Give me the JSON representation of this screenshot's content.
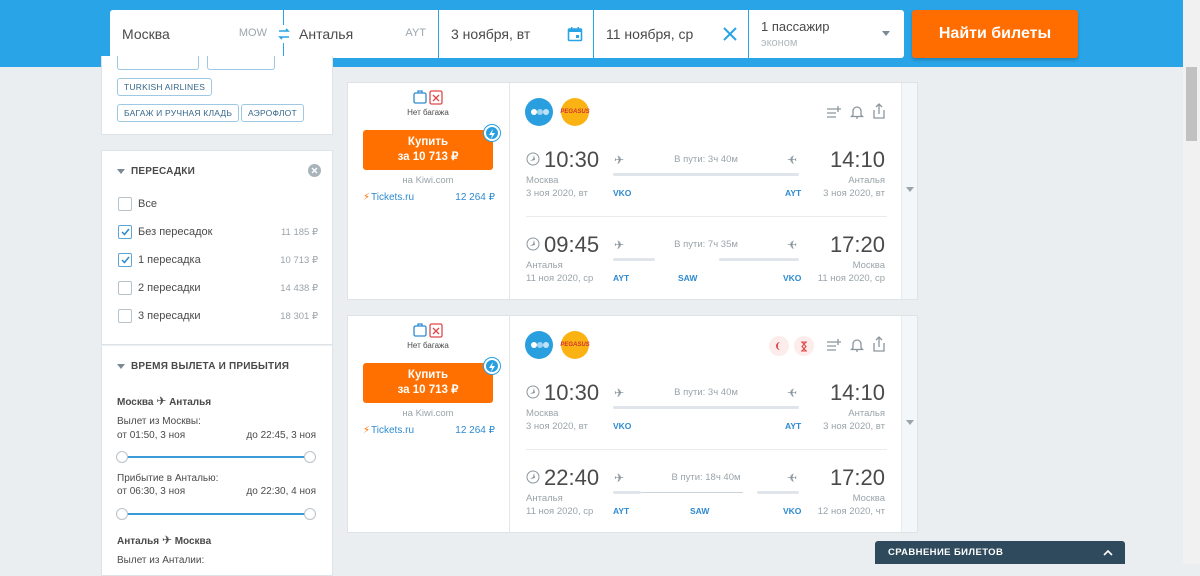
{
  "search": {
    "origin": "Москва",
    "origin_code": "MOW",
    "destination": "Анталья",
    "destination_code": "AYT",
    "depart_date": "3 ноября, вт",
    "return_date": "11 ноября, ср",
    "passengers": "1 пассажир",
    "cabin": "эконом",
    "search_button": "Найти билеты"
  },
  "filters": {
    "airline_tags": [
      "TURKISH AIRLINES",
      "БАГАЖ И РУЧНАЯ КЛАДЬ",
      "АЭРОФЛОТ"
    ],
    "stops": {
      "title": "ПЕРЕСАДКИ",
      "options": [
        {
          "label": "Все",
          "price": "",
          "checked": false
        },
        {
          "label": "Без пересадок",
          "price": "11 185 ₽",
          "checked": true
        },
        {
          "label": "1 пересадка",
          "price": "10 713 ₽",
          "checked": true
        },
        {
          "label": "2 пересадки",
          "price": "14 438 ₽",
          "checked": false
        },
        {
          "label": "3 пересадки",
          "price": "18 301 ₽",
          "checked": false
        }
      ]
    },
    "times": {
      "title": "ВРЕМЯ ВЫЛЕТА И ПРИБЫТИЯ",
      "route1": "Москва",
      "route1_to": "Анталья",
      "dep_label": "Вылет из Москвы:",
      "dep_from": "от 01:50, 3 ноя",
      "dep_to": "до 22:45, 3 ноя",
      "arr_label": "Прибытие в Анталью:",
      "arr_from": "от 06:30, 3 ноя",
      "arr_to": "до 22:30, 4 ноя",
      "route2": "Анталья",
      "route2_to": "Москва",
      "dep2_label": "Вылет из Анталии:"
    }
  },
  "tickets": [
    {
      "baggage": "Нет багажа",
      "buy_label": "Купить",
      "buy_price": "за 10 713 ₽",
      "agency": "на Kiwi.com",
      "alt_agency": "Tickets.ru",
      "alt_price": "12 264 ₽",
      "airline_logo": "PEGASUS",
      "outbound": {
        "dep_time": "10:30",
        "dep_city": "Москва",
        "dep_date": "3 ноя 2020, вт",
        "arr_time": "14:10",
        "arr_city": "Анталья",
        "arr_date": "3 ноя 2020, вт",
        "duration": "В пути: 3ч 40м",
        "from_code": "VKO",
        "to_code": "AYT",
        "via": ""
      },
      "inbound": {
        "dep_time": "09:45",
        "dep_city": "Анталья",
        "dep_date": "11 ноя 2020, ср",
        "arr_time": "17:20",
        "arr_city": "Москва",
        "arr_date": "11 ноя 2020, ср",
        "duration": "В пути: 7ч 35м",
        "from_code": "AYT",
        "to_code": "VKO",
        "via": "SAW"
      }
    },
    {
      "baggage": "Нет багажа",
      "buy_label": "Купить",
      "buy_price": "за 10 713 ₽",
      "agency": "на Kiwi.com",
      "alt_agency": "Tickets.ru",
      "alt_price": "12 264 ₽",
      "airline_logo": "PEGASUS",
      "outbound": {
        "dep_time": "10:30",
        "dep_city": "Москва",
        "dep_date": "3 ноя 2020, вт",
        "arr_time": "14:10",
        "arr_city": "Анталья",
        "arr_date": "3 ноя 2020, вт",
        "duration": "В пути: 3ч 40м",
        "from_code": "VKO",
        "to_code": "AYT",
        "via": ""
      },
      "inbound": {
        "dep_time": "22:40",
        "dep_city": "Анталья",
        "dep_date": "11 ноя 2020, ср",
        "arr_time": "17:20",
        "arr_city": "Москва",
        "arr_date": "12 ноя 2020, чт",
        "duration": "В пути: 18ч 40м",
        "from_code": "AYT",
        "to_code": "VKO",
        "via": "SAW"
      }
    }
  ],
  "compare_bar": "СРАВНЕНИЕ БИЛЕТОВ",
  "colors": {
    "header": "#29a4e6",
    "accent": "#ff6d00",
    "link": "#2d8ad0"
  }
}
